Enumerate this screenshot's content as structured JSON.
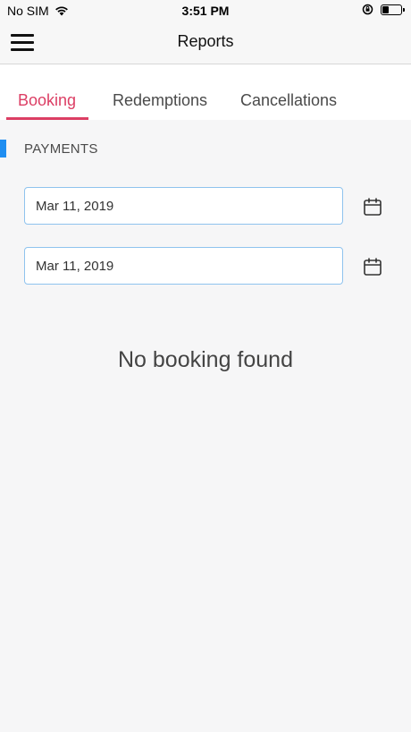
{
  "status_bar": {
    "carrier": "No SIM",
    "time": "3:51 PM",
    "battery_level": 0.4,
    "icons": [
      "wifi-icon",
      "orientation-lock-icon",
      "battery-icon"
    ]
  },
  "header": {
    "title": "Reports",
    "menu_icon": "hamburger-menu-icon"
  },
  "tabs": [
    {
      "label": "Booking",
      "active": true
    },
    {
      "label": "Redemptions",
      "active": false
    },
    {
      "label": "Cancellations",
      "active": false
    }
  ],
  "section": {
    "label": "PAYMENTS",
    "marker_color": "#1f8ef1"
  },
  "date_filters": [
    {
      "value": "Mar 11, 2019",
      "icon": "calendar-icon"
    },
    {
      "value": "Mar 11, 2019",
      "icon": "calendar-icon"
    }
  ],
  "empty_state": {
    "message": "No booking found"
  },
  "colors": {
    "accent": "#dc3e64",
    "field_border": "#8fc3ee"
  }
}
